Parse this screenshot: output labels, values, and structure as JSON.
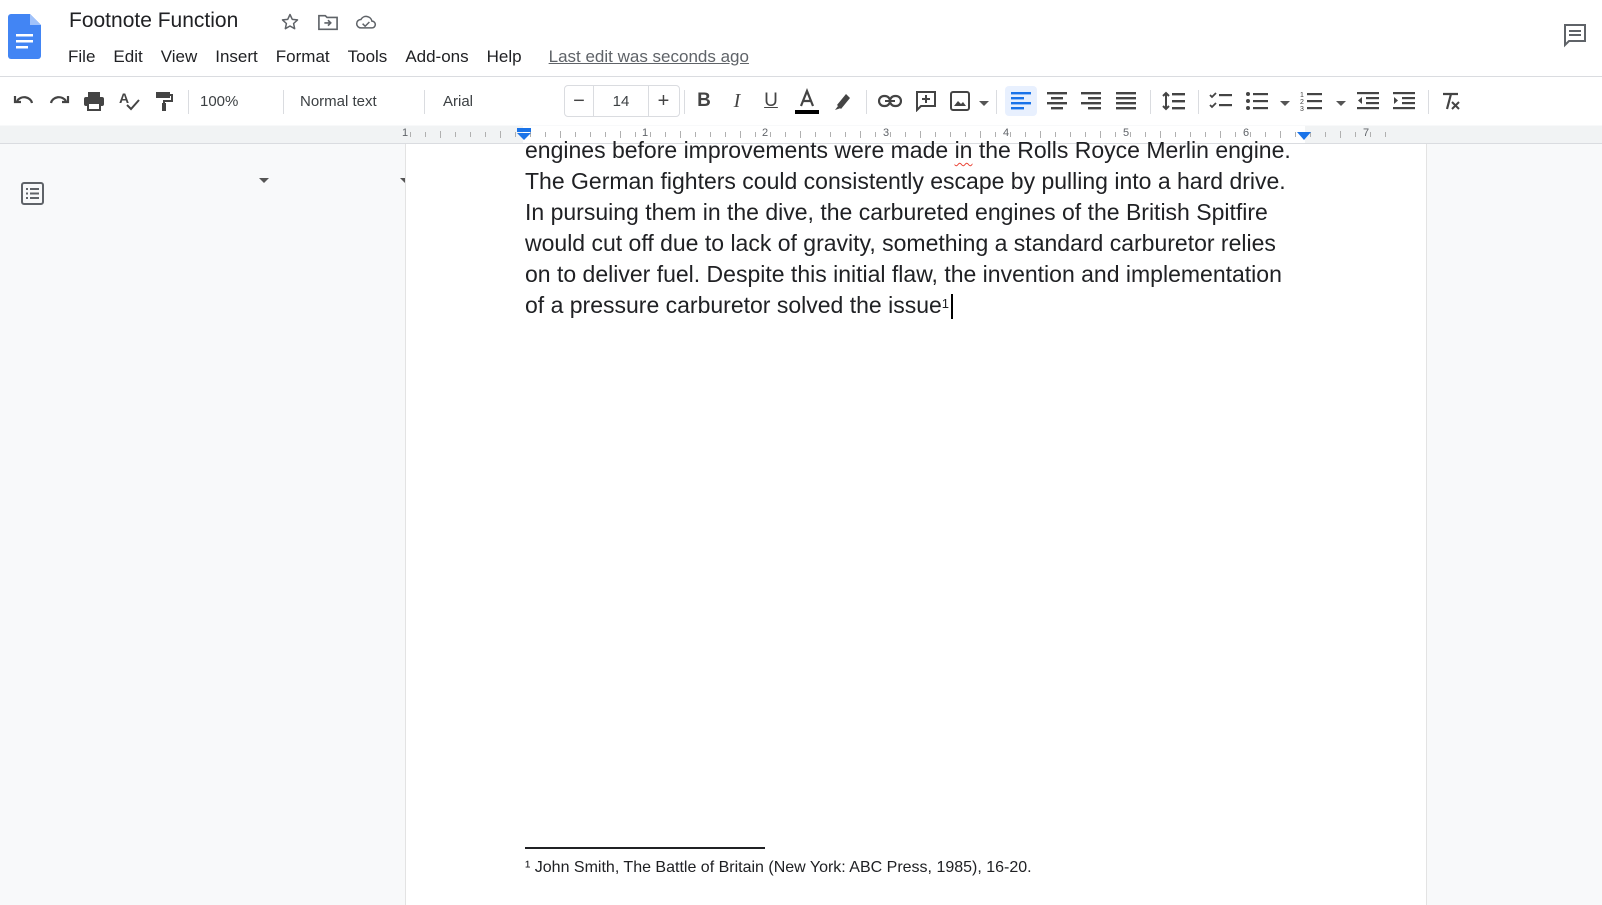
{
  "app": {
    "title": "Footnote Function",
    "last_edit": "Last edit was seconds ago"
  },
  "menu": [
    "File",
    "Edit",
    "View",
    "Insert",
    "Format",
    "Tools",
    "Add-ons",
    "Help"
  ],
  "toolbar": {
    "zoom": "100%",
    "style": "Normal text",
    "font": "Arial",
    "font_size": "14",
    "minus": "−",
    "plus": "+"
  },
  "ruler": {
    "numbers": [
      "1",
      "1",
      "2",
      "3",
      "4",
      "5",
      "6",
      "7"
    ]
  },
  "document": {
    "lines": [
      "engines before improvements were made in the Rolls Royce Merlin engine.",
      "The German fighters could consistently escape by pulling into a hard drive.",
      "In pursuing them in the dive, the carbureted engines of the British Spitfire",
      "would cut off due to lack of gravity, something a standard carburetor relies",
      "on to deliver fuel. Despite this initial flaw, the invention and implementation",
      "of a pressure carburetor solved the issue"
    ],
    "line1_parts": [
      "engines before improvements were made ",
      "in",
      " the Rolls Royce Merlin engine."
    ],
    "footnote_marker": "1",
    "footnote_text": "¹ John Smith, The Battle of Britain (New York: ABC Press, 1985), 16-20."
  },
  "colors": {
    "accent": "#1a73e8",
    "doc_icon": "#4285f4",
    "text": "#202124",
    "spell_underline": "#ea4335"
  }
}
